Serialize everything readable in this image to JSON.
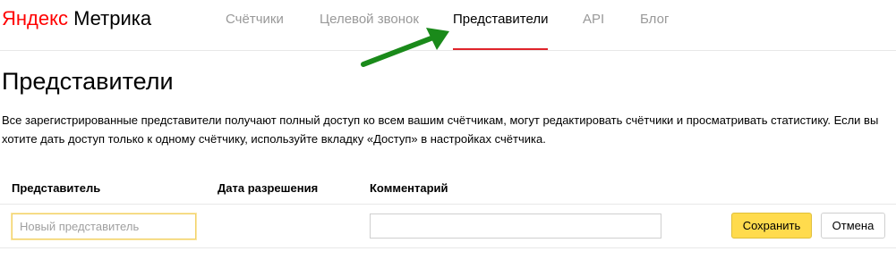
{
  "header": {
    "logo_ya": "Яндекс",
    "logo_rest": " Метрика",
    "nav": [
      {
        "label": "Счётчики",
        "active": false
      },
      {
        "label": "Целевой звонок",
        "active": false
      },
      {
        "label": "Представители",
        "active": true
      },
      {
        "label": "API",
        "active": false
      },
      {
        "label": "Блог",
        "active": false
      }
    ]
  },
  "annotation": {
    "icon": "green-arrow-icon",
    "color": "#1a8a1a"
  },
  "page": {
    "title": "Представители",
    "description": "Все зарегистрированные представители получают полный доступ ко всем вашим счётчикам, могут редактировать счётчики и просматривать статистику. Если вы хотите дать доступ только к одному счётчику, используйте вкладку «Доступ» в настройках счётчика."
  },
  "table": {
    "columns": [
      "Представитель",
      "Дата разрешения",
      "Комментарий"
    ],
    "new_row": {
      "representative_value": "",
      "representative_placeholder": "Новый представитель",
      "comment_value": "",
      "comment_placeholder": ""
    }
  },
  "actions": {
    "save_label": "Сохранить",
    "cancel_label": "Отмена"
  },
  "colors": {
    "accent_red": "#e0242b",
    "button_yellow": "#ffdb4d",
    "logo_red": "#ff0000"
  }
}
